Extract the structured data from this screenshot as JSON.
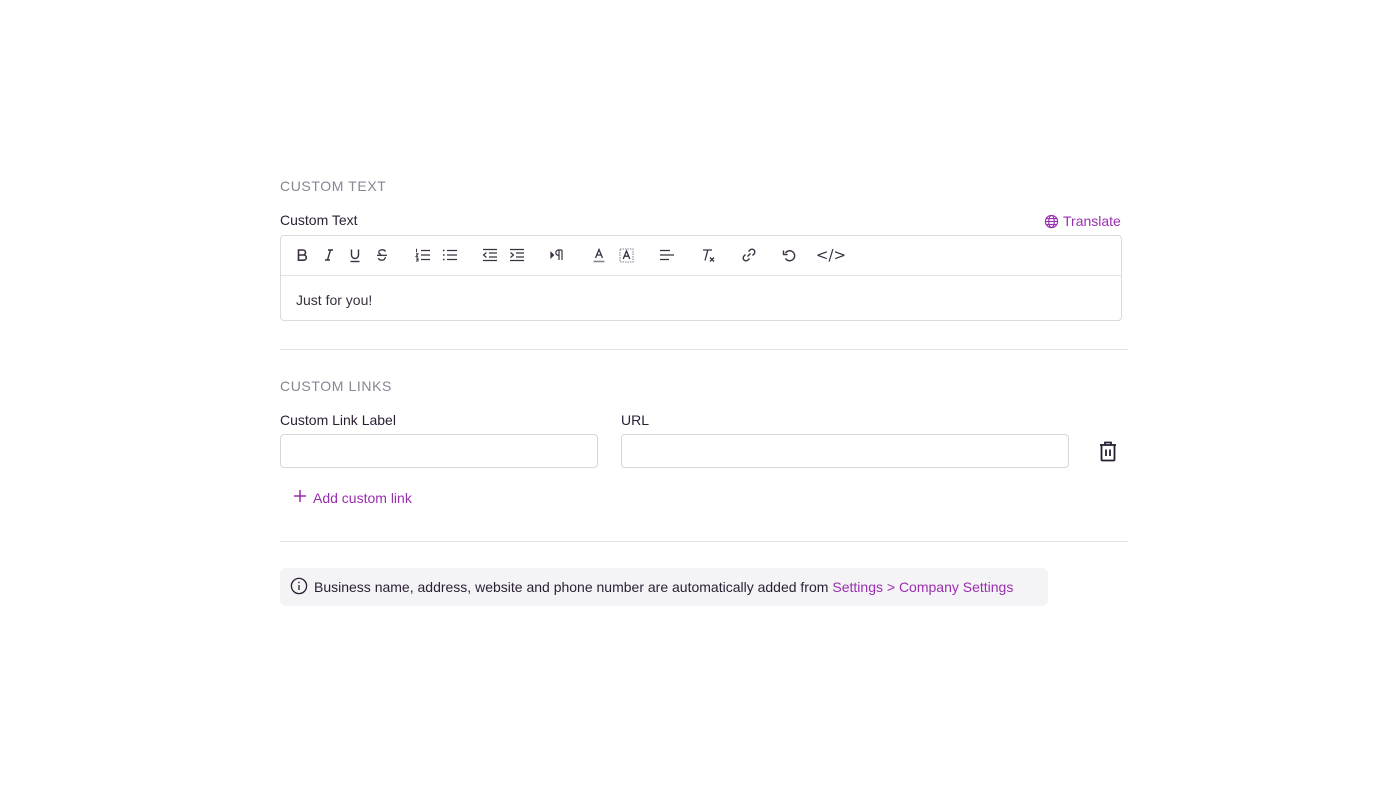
{
  "custom_text_section": {
    "heading": "CUSTOM TEXT",
    "field_label": "Custom Text",
    "translate_label": "Translate",
    "editor_content": "Just for you!",
    "toolbar": {
      "code_label": "</>"
    }
  },
  "custom_links_section": {
    "heading": "CUSTOM LINKS",
    "label_field_label": "Custom Link Label",
    "url_field_label": "URL",
    "label_value": "",
    "url_value": "",
    "add_link_label": "Add custom link"
  },
  "notice": {
    "text": "Business name, address, website and phone number are automatically added from",
    "link_text": "Settings > Company Settings"
  },
  "colors": {
    "accent": "#9a2fb0",
    "heading_gray": "#8b8492",
    "notice_bg": "#f4f3f5"
  }
}
